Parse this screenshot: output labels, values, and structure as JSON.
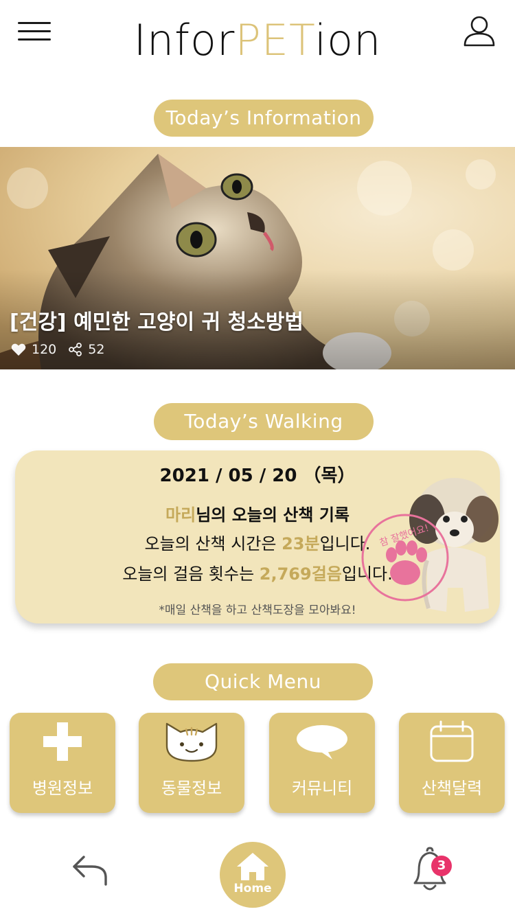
{
  "header": {
    "logo_prefix": "Infor",
    "logo_highlight": "PET",
    "logo_suffix": "ion"
  },
  "sections": {
    "info_title": "Today’s Information",
    "walking_title": "Today’s Walking",
    "quick_title": "Quick Menu"
  },
  "banner": {
    "title": "[건강] 예민한 고양이 귀 청소방법",
    "likes": "120",
    "shares": "52"
  },
  "walking": {
    "date": "2021 / 05 / 20 （목）",
    "pet_name": "마리",
    "record_suffix": "님의 오늘의 산책 기록",
    "time_prefix": "오늘의 산책 시간은 ",
    "time_value": "23분",
    "time_suffix": "입니다.",
    "steps_prefix": "오늘의 걸음 횟수는 ",
    "steps_value": "2,769걸음",
    "steps_suffix": "입니다.",
    "note": "*매일 산책을 하고 산책도장을 모아봐요!",
    "stamp_text": "참 잘했어요!"
  },
  "quick_menu": [
    {
      "label": "병원정보",
      "icon": "plus-icon"
    },
    {
      "label": "동물정보",
      "icon": "cat-face-icon"
    },
    {
      "label": "커뮤니티",
      "icon": "speech-bubble-icon"
    },
    {
      "label": "산책달력",
      "icon": "calendar-icon"
    }
  ],
  "tabbar": {
    "home_label": "Home",
    "notification_count": "3"
  },
  "colors": {
    "accent": "#dec67a",
    "card_bg": "#f2e5bb",
    "highlight_text": "#c5a95a",
    "stamp": "#e8739c",
    "badge": "#e8336a"
  }
}
